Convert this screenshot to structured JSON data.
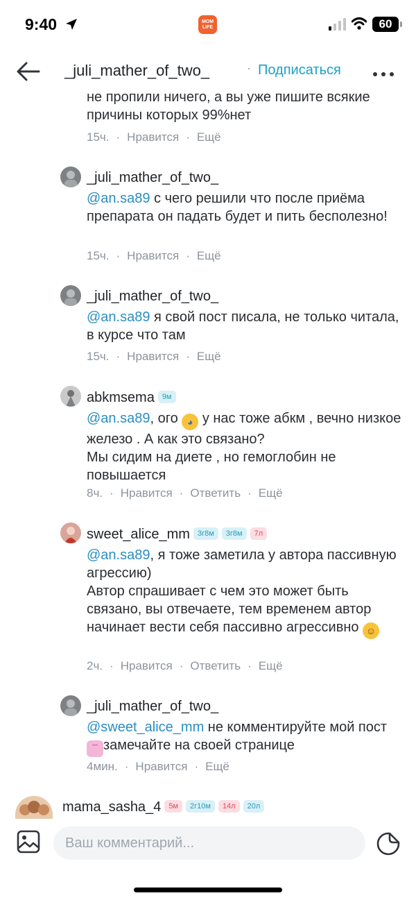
{
  "status_bar": {
    "time": "9:40",
    "app_badge": "MOM LIFE",
    "battery": "60"
  },
  "header": {
    "username": "_juli_mather_of_two_",
    "separator": "·",
    "subscribe_label": "Подписаться"
  },
  "comments": [
    {
      "text": "не пропили ничего, а вы уже пишите всякие причины которых 99%нет",
      "time": "15ч.",
      "like": "Нравится",
      "more": "Ещё"
    },
    {
      "username": "_juli_mather_of_two_",
      "mention": "@an.sa89",
      "text": " с чего решили что после приёма препарата он падать будет и пить бесполезно!",
      "time": "15ч.",
      "like": "Нравится",
      "more": "Ещё"
    },
    {
      "username": "_juli_mather_of_two_",
      "mention": "@an.sa89",
      "text": " я свой пост писала, не только читала, в курсе что там",
      "time": "15ч.",
      "like": "Нравится",
      "more": "Ещё"
    },
    {
      "username": "abkmsema",
      "tags": [
        "9м"
      ],
      "mention": "@an.sa89",
      "text_before_emoji": ", ого ",
      "text_after_emoji": " у нас тоже абкм , вечно низкое железо . А как это связано?",
      "text_line2": "Мы сидим на диете , но гемоглобин не повышается",
      "time": "8ч.",
      "like": "Нравится",
      "reply": "Ответить",
      "more": "Ещё"
    },
    {
      "username": "sweet_alice_mm",
      "tags": [
        "3г8м",
        "3г8м",
        "7л"
      ],
      "mention": "@an.sa89",
      "text": ", я тоже заметила у автора пассивную агрессию)",
      "text_line2": "Автор спрашивает с чем это может быть связано, вы отвечаете, тем временем автор начинает вести себя пассивно агрессивно ",
      "time": "2ч.",
      "like": "Нравится",
      "reply": "Ответить",
      "more": "Ещё"
    },
    {
      "username": "_juli_mather_of_two_",
      "mention": "@sweet_alice_mm",
      "text_before_emoji": " не комментируйте мой пост ",
      "text_after_emoji": "замечайте на своей странице",
      "time": "4мин.",
      "like": "Нравится",
      "more": "Ещё"
    }
  ],
  "next_comment": {
    "username": "mama_sasha_4",
    "tags": [
      "5м",
      "2г10м",
      "14л",
      "20л"
    ]
  },
  "input": {
    "placeholder": "Ваш комментарий..."
  },
  "colors": {
    "accent": "#1aa2c4",
    "mention": "#2b8ec2",
    "meta": "#8c949c",
    "tag_blue_bg": "#d8f0f7",
    "tag_pink_bg": "#fbdde2"
  },
  "icons": [
    "back-arrow-icon",
    "more-icon",
    "image-icon",
    "sticker-icon",
    "location-arrow-icon",
    "signal-icon",
    "wifi-icon"
  ]
}
